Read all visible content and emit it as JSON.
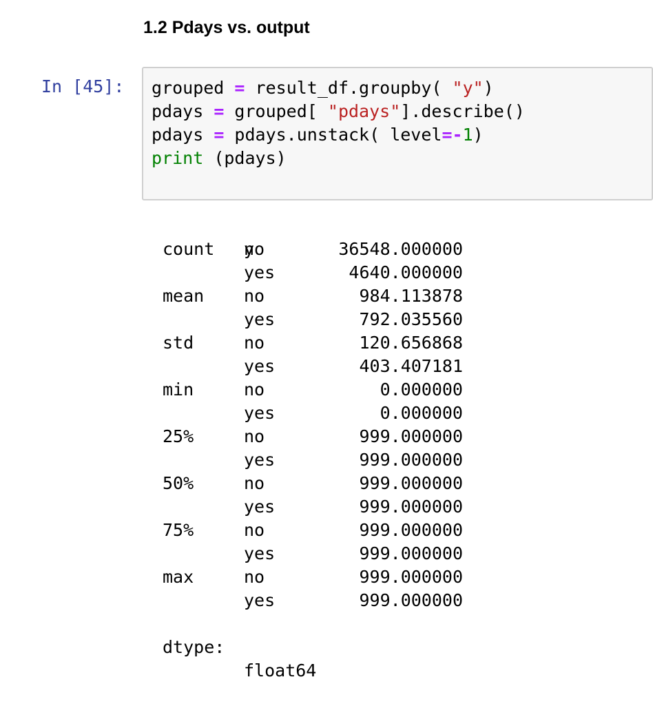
{
  "heading": "1.2 Pdays vs. output",
  "cell": {
    "prompt": "In [45]:",
    "code_lines": [
      [
        {
          "t": "grouped ",
          "c": ""
        },
        {
          "t": "=",
          "c": "op"
        },
        {
          "t": " result_df.groupby( ",
          "c": ""
        },
        {
          "t": "\"y\"",
          "c": "str"
        },
        {
          "t": ")",
          "c": ""
        }
      ],
      [
        {
          "t": "pdays ",
          "c": ""
        },
        {
          "t": "=",
          "c": "op"
        },
        {
          "t": " grouped[ ",
          "c": ""
        },
        {
          "t": "\"pdays\"",
          "c": "str"
        },
        {
          "t": "].describe()",
          "c": ""
        }
      ],
      [
        {
          "t": "pdays ",
          "c": ""
        },
        {
          "t": "=",
          "c": "op"
        },
        {
          "t": " pdays.unstack( level",
          "c": ""
        },
        {
          "t": "=-",
          "c": "op"
        },
        {
          "t": "1",
          "c": "num"
        },
        {
          "t": ")",
          "c": ""
        }
      ],
      [
        {
          "t": "print",
          "c": "kw"
        },
        {
          "t": " (",
          "c": ""
        },
        {
          "t": "pdays",
          "c": ""
        },
        {
          "t": ")",
          "c": ""
        }
      ]
    ]
  },
  "output": {
    "index_header": "y",
    "rows": [
      {
        "stat": "count",
        "y": "no",
        "value": "36548.000000"
      },
      {
        "stat": "",
        "y": "yes",
        "value": "4640.000000"
      },
      {
        "stat": "mean",
        "y": "no",
        "value": "984.113878"
      },
      {
        "stat": "",
        "y": "yes",
        "value": "792.035560"
      },
      {
        "stat": "std",
        "y": "no",
        "value": "120.656868"
      },
      {
        "stat": "",
        "y": "yes",
        "value": "403.407181"
      },
      {
        "stat": "min",
        "y": "no",
        "value": "0.000000"
      },
      {
        "stat": "",
        "y": "yes",
        "value": "0.000000"
      },
      {
        "stat": "25%",
        "y": "no",
        "value": "999.000000"
      },
      {
        "stat": "",
        "y": "yes",
        "value": "999.000000"
      },
      {
        "stat": "50%",
        "y": "no",
        "value": "999.000000"
      },
      {
        "stat": "",
        "y": "yes",
        "value": "999.000000"
      },
      {
        "stat": "75%",
        "y": "no",
        "value": "999.000000"
      },
      {
        "stat": "",
        "y": "yes",
        "value": "999.000000"
      },
      {
        "stat": "max",
        "y": "no",
        "value": "999.000000"
      },
      {
        "stat": "",
        "y": "yes",
        "value": "999.000000"
      }
    ],
    "dtype_label": "dtype:",
    "dtype_value": "float64"
  },
  "colors": {
    "prompt": "#303f9f",
    "operator": "#aa22ff",
    "string": "#ba2121",
    "number": "#008000",
    "builtin": "#008000",
    "cell_background": "#f7f7f7",
    "cell_border": "#cfcfcf"
  }
}
